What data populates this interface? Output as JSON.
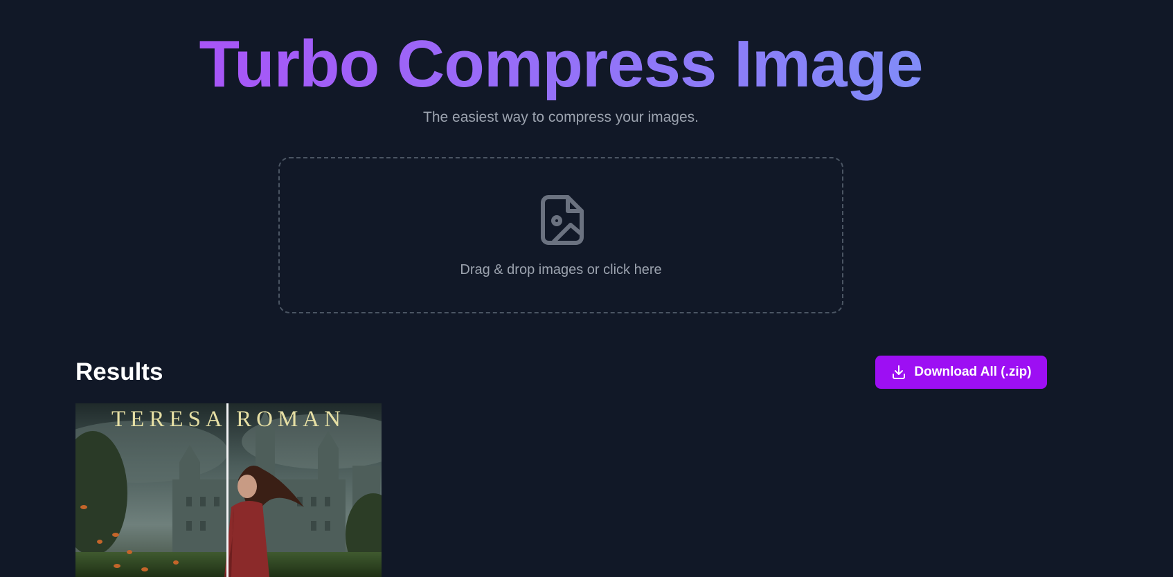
{
  "header": {
    "title": "Turbo Compress Image",
    "subtitle": "The easiest way to compress your images."
  },
  "dropzone": {
    "label": "Drag & drop images or click here",
    "icon": "image-file-icon"
  },
  "results": {
    "title": "Results",
    "download_all_label": "Download All (.zip)",
    "download_icon": "download-icon",
    "items": [
      {
        "cover_author_text": "TERESA ROMAN"
      }
    ]
  },
  "colors": {
    "background": "#111827",
    "title_gradient_start": "#a855f7",
    "title_gradient_end": "#818cf8",
    "accent_button": "#9d0ff3",
    "muted_text": "#9ca3af",
    "dropzone_border": "#4b5563"
  }
}
